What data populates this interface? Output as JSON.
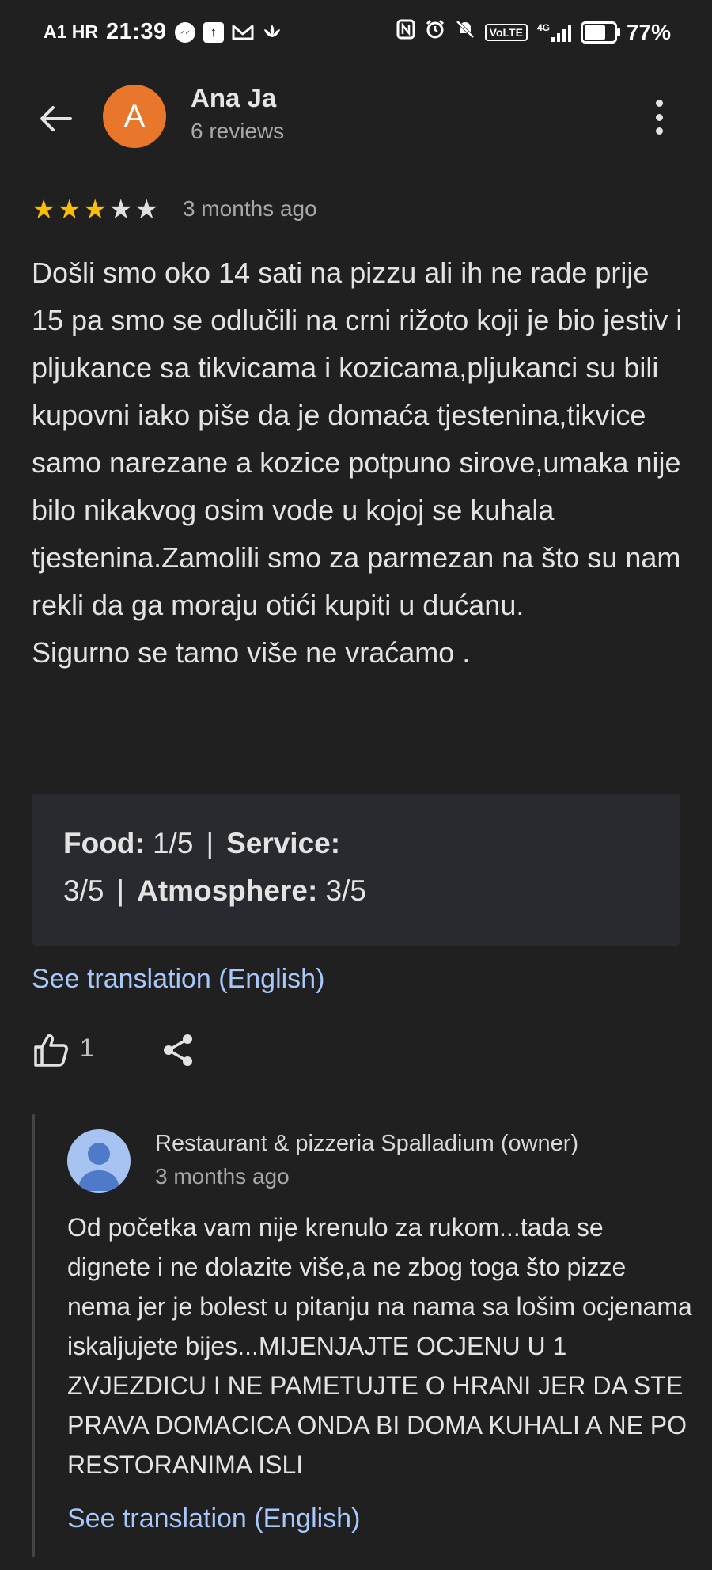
{
  "status_bar": {
    "carrier": "A1 HR",
    "time": "21:39",
    "battery_percent": "77%",
    "battery_level": 0.77,
    "network": "4G",
    "volte": "VoLTE",
    "left_icons": [
      "messenger-icon",
      "upload-icon",
      "gmail-icon",
      "lotus-icon"
    ],
    "right_icons": [
      "nfc-icon",
      "alarm-icon",
      "mute-icon",
      "volte-icon",
      "signal-icon",
      "battery-icon"
    ]
  },
  "header": {
    "author_initial": "A",
    "author_name": "Ana Ja",
    "author_reviews": "6 reviews",
    "avatar_color": "#e8772b"
  },
  "review": {
    "stars_filled": 3,
    "stars_total": 5,
    "time": "3 months ago",
    "text": "Došli smo oko 14 sati na pizzu ali ih ne rade prije 15 pa smo se odlučili na crni rižoto koji je bio jestiv i pljukance sa tikvicama i kozicama,pljukanci su bili kupovni iako piše da je domaća tjestenina,tikvice samo narezane a kozice potpuno sirove,umaka nije bilo nikakvog osim vode u kojoj se kuhala tjestenina.Zamolili smo za parmezan na što su nam rekli da ga moraju otići kupiti u dućanu.\nSigurno se tamo više ne vraćamo ."
  },
  "ratings": {
    "food_label": "Food:",
    "food_value": "1/5",
    "service_label": "Service:",
    "service_value": "3/5",
    "atmosphere_label": "Atmosphere:",
    "atmosphere_value": "3/5",
    "separator": "|"
  },
  "translation_link": "See translation (English)",
  "actions": {
    "like_count": "1"
  },
  "owner_reply": {
    "name": "Restaurant & pizzeria Spalladium (owner)",
    "time": "3 months ago",
    "text": "Od početka vam nije krenulo za rukom...tada se dignete i ne dolazite više,a ne zbog toga što pizze nema jer je bolest u pitanju na nama sa lošim ocjenama iskaljujete bijes...MIJENJAJTE OCJENU U 1 ZVJEZDICU I NE PAMETUJTE O HRANI JER DA STE PRAVA DOMACICA ONDA BI DOMA KUHALI A NE PO RESTORANIMA ISLI",
    "translation_link": "See translation (English)"
  },
  "colors": {
    "background": "#202020",
    "link": "#a8c7fa",
    "star": "#fbbc04"
  }
}
